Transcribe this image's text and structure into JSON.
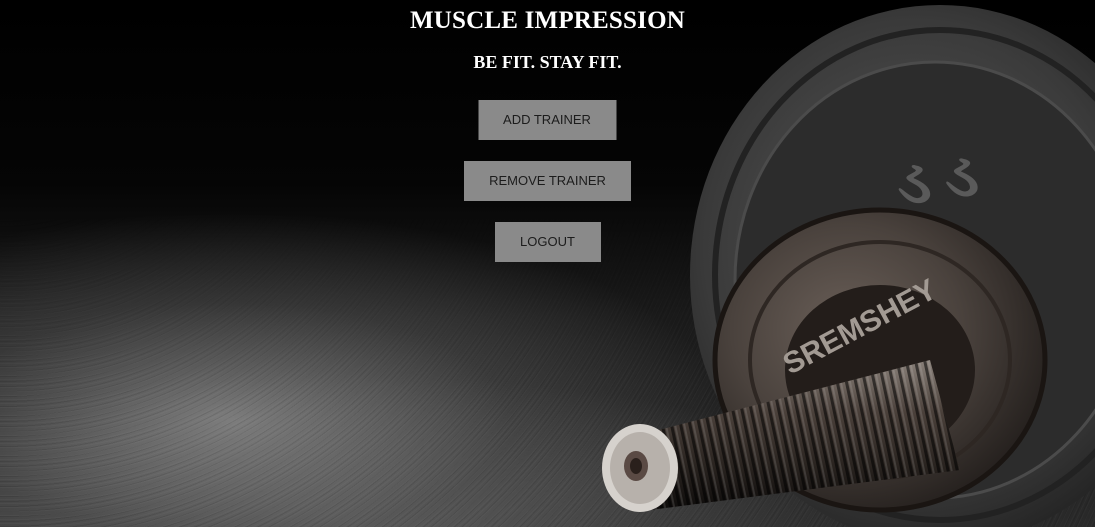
{
  "header": {
    "title": "MUSCLE IMPRESSION",
    "tagline": "BE FIT. STAY FIT."
  },
  "actions": {
    "add_trainer": "ADD TRAINER",
    "remove_trainer": "REMOVE TRAINER",
    "logout": "LOGOUT"
  },
  "background": {
    "plate_text": "SREMSHEY",
    "colors": {
      "page": "#000000",
      "button_bg": "#8a8a8a",
      "button_text": "#1c1c1c",
      "heading_text": "#ffffff"
    }
  }
}
